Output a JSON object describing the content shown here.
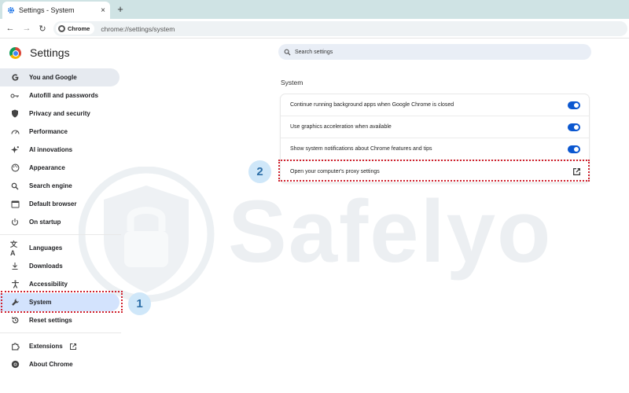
{
  "tab": {
    "title": "Settings - System",
    "close": "×",
    "new_tab": "+"
  },
  "toolbar": {
    "back": "←",
    "forward": "→",
    "reload": "↻",
    "chip_label": "Chrome",
    "url": "chrome://settings/system"
  },
  "header": {
    "title": "Settings",
    "search_placeholder": "Search settings"
  },
  "sidebar": {
    "items": [
      {
        "label": "You and Google",
        "icon": "google-g-icon"
      },
      {
        "label": "Autofill and passwords",
        "icon": "key-icon"
      },
      {
        "label": "Privacy and security",
        "icon": "shield-icon"
      },
      {
        "label": "Performance",
        "icon": "speedometer-icon"
      },
      {
        "label": "AI innovations",
        "icon": "sparkle-icon"
      },
      {
        "label": "Appearance",
        "icon": "palette-icon"
      },
      {
        "label": "Search engine",
        "icon": "search-icon"
      },
      {
        "label": "Default browser",
        "icon": "browser-icon"
      },
      {
        "label": "On startup",
        "icon": "power-icon"
      },
      {
        "label": "Languages",
        "icon": "translate-icon"
      },
      {
        "label": "Downloads",
        "icon": "download-icon"
      },
      {
        "label": "Accessibility",
        "icon": "accessibility-icon"
      },
      {
        "label": "System",
        "icon": "wrench-icon"
      },
      {
        "label": "Reset settings",
        "icon": "reset-icon"
      },
      {
        "label": "Extensions",
        "icon": "puzzle-icon"
      },
      {
        "label": "About Chrome",
        "icon": "chrome-icon"
      }
    ]
  },
  "main": {
    "section_title": "System",
    "rows": [
      {
        "label": "Continue running background apps when Google Chrome is closed",
        "enabled": true
      },
      {
        "label": "Use graphics acceleration when available",
        "enabled": true
      },
      {
        "label": "Show system notifications about Chrome features and tips",
        "enabled": true
      },
      {
        "label": "Open your computer's proxy settings"
      }
    ]
  },
  "annotations": {
    "step1": "1",
    "step2": "2"
  },
  "watermark": {
    "text": "Safelyo"
  },
  "colors": {
    "accent": "#0b57d0",
    "selected_bg": "#d3e3fd",
    "annotation_red": "#d0222e",
    "badge_bg": "#cfe7f9"
  }
}
